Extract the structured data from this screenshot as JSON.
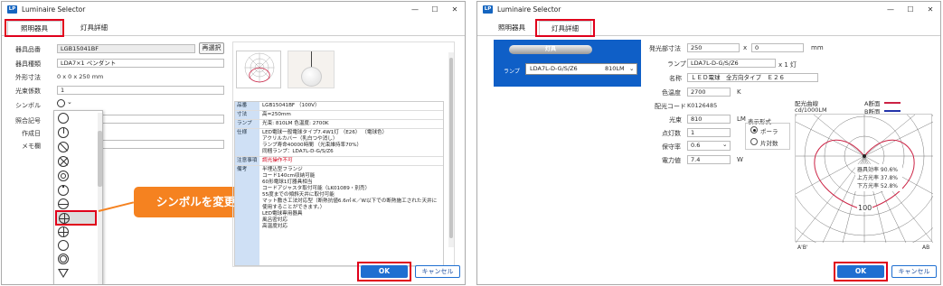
{
  "app": {
    "icon_text": "LP",
    "title": "Luminaire Selector",
    "window_controls": [
      "—",
      "☐",
      "✕"
    ]
  },
  "tabs": [
    "照明器具",
    "灯具詳細"
  ],
  "left": {
    "fields": [
      {
        "label": "器具品番",
        "value": "LGB15041BF"
      },
      {
        "label": "器具種類",
        "value": "LDA7×1 ペンダント"
      },
      {
        "label": "外形寸法",
        "value": "0 x 0 x 250 mm"
      },
      {
        "label": "光束係数",
        "value": "1"
      },
      {
        "label": "シンボル",
        "value": ""
      },
      {
        "label": "照合記号",
        "value": ""
      },
      {
        "label": "作成日",
        "value": ""
      },
      {
        "label": "メモ欄",
        "value": ""
      }
    ],
    "reselect_button": "再選択",
    "symbol_options": [
      "○",
      "⊤",
      "⊘",
      "⊗",
      "◎",
      "⊖",
      "⊝",
      "⊕",
      "⊕",
      "○",
      "◎",
      "▽"
    ],
    "selected_symbol_index": 7,
    "callout": "シンボルを変更",
    "spec": [
      {
        "k": "品番",
        "v": "LGB15041BF （100V）"
      },
      {
        "k": "寸法",
        "v": "高=250mm"
      },
      {
        "k": "ランプ",
        "v": "光束: 810LM 色温度: 2700K"
      },
      {
        "k": "仕様",
        "v": "LED電球一般電球タイプ7.4W1灯 （E26） （電球色）\nアクリルカバー（乳白つや消し）\nランプ寿命40000時間 （光束維持率70%）\n同梱ランプ：LDA7L-D-G/S/Z6"
      },
      {
        "k": "注意事項",
        "v": "調光操作不可"
      },
      {
        "k": "備考",
        "v": "半埋込型フランジ\nコード140cm収納可能\n60形電球1灯器具相当\nコードアジャスタ取付可能（LK01089・別売）\n55度までの傾斜天井に取付可能\nマット敷き工法対応型（断熱抗値6.6㎡·K／W以下での断熱施工された天井に使用することができます。）\nLED電球専用器具\n風呂密対応\n高温度対応"
      }
    ],
    "spec_note_color": "#d0021b",
    "ok": "OK",
    "cancel": "キャンセル"
  },
  "right": {
    "selector_label": "灯具",
    "lamp_label": "ランプ",
    "lamp_value": "LDA7L-D-G/S/Z6",
    "lamp_lm": "810LM",
    "fields": {
      "emit_size_label": "発光部寸法",
      "emit_w": "250",
      "x": "x",
      "emit_d": "0",
      "mm": "mm",
      "lamp_label": "ランプ",
      "lamp_value": "LDA7L-D-G/S/Z6",
      "lamp_unit": "x 1 灯",
      "name_label": "名称",
      "name_value": "ＬＥＤ電球　全方向タイプ　Ｅ２６",
      "ct_label": "色温度",
      "ct_value": "2700",
      "ct_unit": "K",
      "code_label": "配光コード",
      "code_value": "K0126485",
      "flux_label": "光束",
      "flux_value": "810",
      "flux_unit": "LM",
      "count_label": "点灯数",
      "count_value": "1",
      "maint_label": "保守率",
      "maint_value": "0.6",
      "power_label": "電力値",
      "power_value": "7.4",
      "power_unit": "W"
    },
    "display_form_label": "表示形式",
    "display_options": [
      "ポーラ",
      "片対数"
    ],
    "selected_display": 0,
    "curve_title": "配光曲線",
    "curve_unit": "cd/1000LM",
    "legend_a": "A断面",
    "legend_b": "B断面",
    "stats": [
      "器具効率 90.6%",
      "上方光率 37.8%",
      "下方光率 52.8%"
    ],
    "polar_tick": "100",
    "axis_left": "A'B'",
    "axis_right": "AB",
    "ok": "OK",
    "cancel": "キャンセル"
  },
  "colors": {
    "accent": "#1f6fd1",
    "highlight": "#e0001b",
    "selector_bg": "#0f5fc7",
    "callout": "#f58220",
    "curve_a": "#cc2244",
    "curve_b": "#2233aa"
  }
}
